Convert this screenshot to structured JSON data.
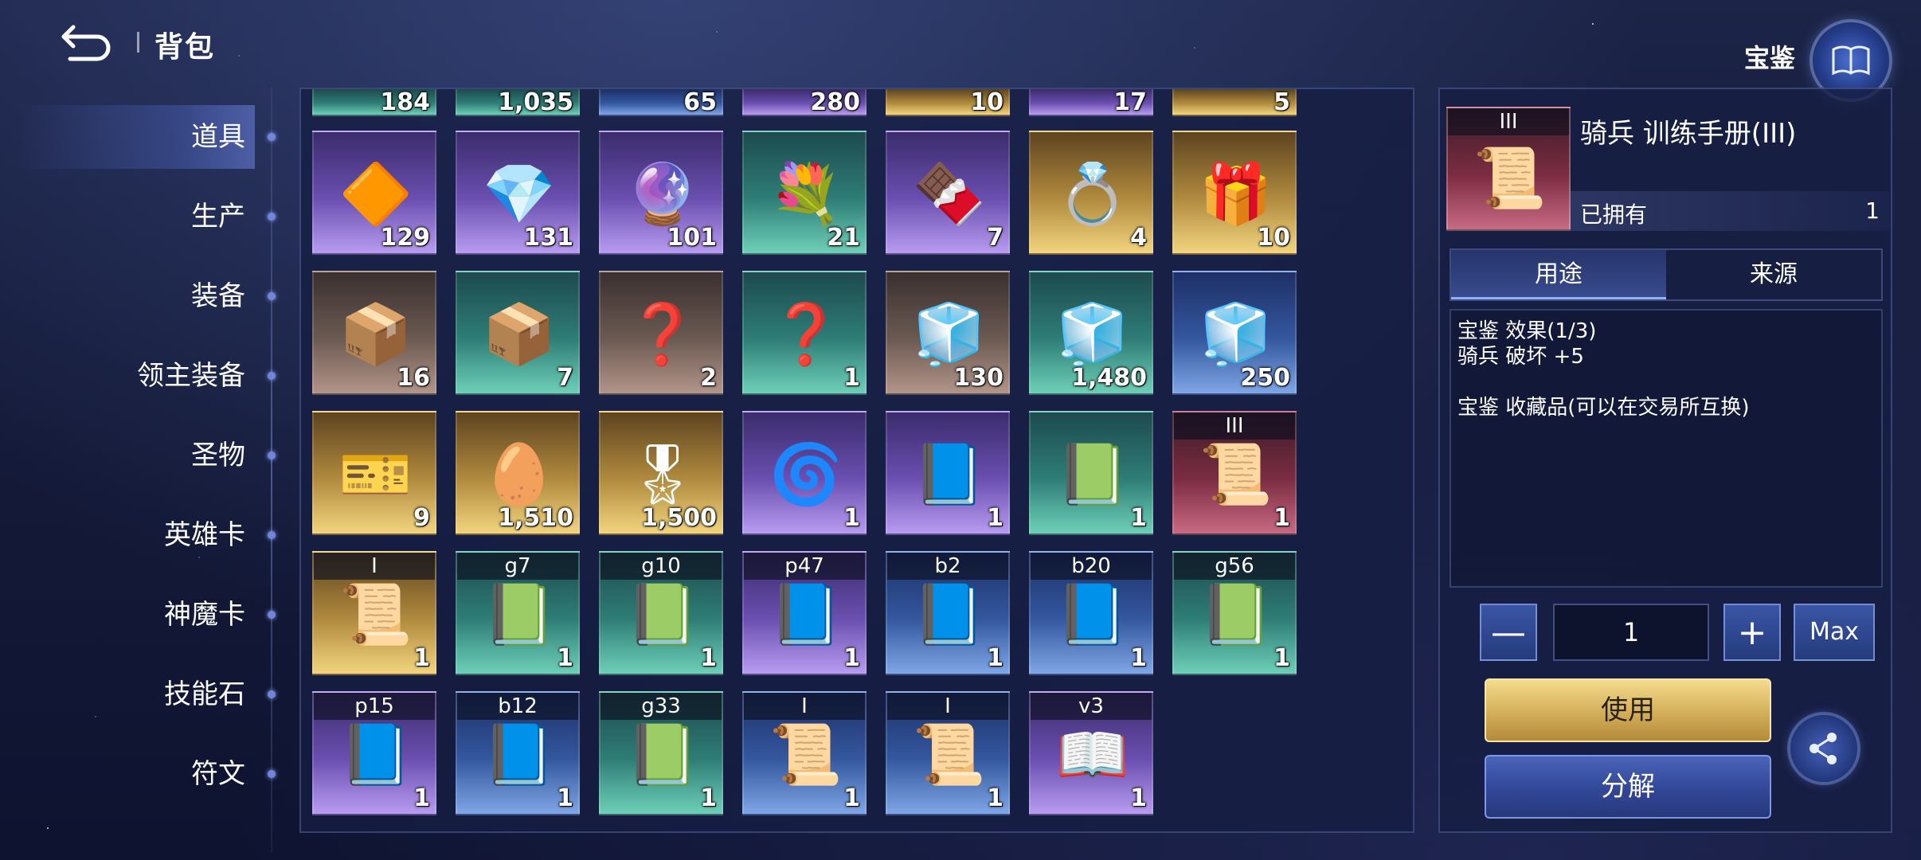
{
  "header": {
    "title": "背包",
    "codex_label": "宝鉴"
  },
  "sidebar": {
    "items": [
      {
        "label": "道具",
        "active": true
      },
      {
        "label": "生产",
        "active": false
      },
      {
        "label": "装备",
        "active": false
      },
      {
        "label": "领主装备",
        "active": false
      },
      {
        "label": "圣物",
        "active": false
      },
      {
        "label": "英雄卡",
        "active": false
      },
      {
        "label": "神魔卡",
        "active": false
      },
      {
        "label": "技能石",
        "active": false
      },
      {
        "label": "符文",
        "active": false
      }
    ]
  },
  "grid": {
    "top_strip": [
      {
        "count": "184",
        "quality": "teal"
      },
      {
        "count": "1,035",
        "quality": "teal"
      },
      {
        "count": "65",
        "quality": "blue"
      },
      {
        "count": "280",
        "quality": "purple"
      },
      {
        "count": "10",
        "quality": "gold"
      },
      {
        "count": "17",
        "quality": "purple"
      },
      {
        "count": "5",
        "quality": "gold"
      }
    ],
    "rows": [
      [
        {
          "count": "129",
          "quality": "purple",
          "icon": "orange-crystal-icon",
          "glyph": "🔶",
          "tag": ""
        },
        {
          "count": "131",
          "quality": "purple",
          "icon": "blue-crystal-icon",
          "glyph": "💎",
          "tag": ""
        },
        {
          "count": "101",
          "quality": "purple",
          "icon": "violet-crystal-icon",
          "glyph": "🔮",
          "tag": ""
        },
        {
          "count": "21",
          "quality": "teal",
          "icon": "flower-bouquet-icon",
          "glyph": "💐",
          "tag": ""
        },
        {
          "count": "7",
          "quality": "purple",
          "icon": "chocolate-box-icon",
          "glyph": "🍫",
          "tag": ""
        },
        {
          "count": "4",
          "quality": "gold",
          "icon": "ring-box-icon",
          "glyph": "💍",
          "tag": ""
        },
        {
          "count": "10",
          "quality": "gold",
          "icon": "gift-chest-icon",
          "glyph": "🎁",
          "tag": ""
        }
      ],
      [
        {
          "count": "16",
          "quality": "brown",
          "icon": "gold-chest-icon",
          "glyph": "📦",
          "tag": ""
        },
        {
          "count": "7",
          "quality": "teal",
          "icon": "gold-chest-icon",
          "glyph": "📦",
          "tag": ""
        },
        {
          "count": "2",
          "quality": "brown",
          "icon": "mystery-chest-icon",
          "glyph": "❓",
          "tag": ""
        },
        {
          "count": "1",
          "quality": "teal",
          "icon": "mystery-chest-icon",
          "glyph": "❓",
          "tag": ""
        },
        {
          "count": "130",
          "quality": "brown",
          "icon": "crystal-chest-icon",
          "glyph": "🧊",
          "tag": ""
        },
        {
          "count": "1,480",
          "quality": "teal",
          "icon": "crystal-chest-icon",
          "glyph": "🧊",
          "tag": ""
        },
        {
          "count": "250",
          "quality": "blue",
          "icon": "crystal-chest-icon",
          "glyph": "🧊",
          "tag": ""
        }
      ],
      [
        {
          "count": "9",
          "quality": "gold",
          "icon": "ticket-icon",
          "glyph": "🎫",
          "tag": ""
        },
        {
          "count": "1,510",
          "quality": "gold",
          "icon": "easter-egg-icon",
          "glyph": "🥚",
          "tag": ""
        },
        {
          "count": "1,500",
          "quality": "gold",
          "icon": "medal-icon",
          "glyph": "🎖",
          "tag": ""
        },
        {
          "count": "1",
          "quality": "purple",
          "icon": "portal-scroll-icon",
          "glyph": "🌀",
          "tag": ""
        },
        {
          "count": "1",
          "quality": "purple",
          "icon": "skill-book-icon",
          "glyph": "📘",
          "tag": ""
        },
        {
          "count": "1",
          "quality": "teal",
          "icon": "skill-book-icon",
          "glyph": "📗",
          "tag": ""
        },
        {
          "count": "1",
          "quality": "red",
          "icon": "manual-scroll-icon",
          "glyph": "📜",
          "tag": "III"
        }
      ],
      [
        {
          "count": "1",
          "quality": "gold",
          "icon": "manual-scroll-icon",
          "glyph": "📜",
          "tag": "I"
        },
        {
          "count": "1",
          "quality": "teal",
          "icon": "skill-book-icon",
          "glyph": "📗",
          "tag": "g7"
        },
        {
          "count": "1",
          "quality": "teal",
          "icon": "skill-book-icon",
          "glyph": "📗",
          "tag": "g10"
        },
        {
          "count": "1",
          "quality": "purple",
          "icon": "skill-book-icon",
          "glyph": "📘",
          "tag": "p47"
        },
        {
          "count": "1",
          "quality": "blue",
          "icon": "skill-book-icon",
          "glyph": "📘",
          "tag": "b2"
        },
        {
          "count": "1",
          "quality": "blue",
          "icon": "skill-book-icon",
          "glyph": "📘",
          "tag": "b20"
        },
        {
          "count": "1",
          "quality": "teal",
          "icon": "skill-book-icon",
          "glyph": "📗",
          "tag": "g56"
        }
      ],
      [
        {
          "count": "1",
          "quality": "purple",
          "icon": "skill-book-icon",
          "glyph": "📘",
          "tag": "p15"
        },
        {
          "count": "1",
          "quality": "blue",
          "icon": "skill-book-icon",
          "glyph": "📘",
          "tag": "b12"
        },
        {
          "count": "1",
          "quality": "teal",
          "icon": "skill-book-icon",
          "glyph": "📗",
          "tag": "g33"
        },
        {
          "count": "1",
          "quality": "blue",
          "icon": "manual-scroll-icon",
          "glyph": "📜",
          "tag": "I"
        },
        {
          "count": "1",
          "quality": "blue",
          "icon": "manual-scroll-icon",
          "glyph": "📜",
          "tag": "I"
        },
        {
          "count": "1",
          "quality": "purple",
          "icon": "tome-icon",
          "glyph": "📖",
          "tag": "v3"
        }
      ]
    ]
  },
  "detail": {
    "tag": "III",
    "glyph": "📜",
    "name": "骑兵 训练手册(III)",
    "owned_label": "已拥有",
    "owned_value": "1",
    "tabs": [
      "用途",
      "来源"
    ],
    "description": [
      "宝鉴 效果(1/3)",
      "骑兵 破坏 +5",
      "",
      "宝鉴 收藏品(可以在交易所互换)"
    ],
    "minus_label": "—",
    "plus_label": "+",
    "quantity": "1",
    "max_label": "Max",
    "use_label": "使用",
    "decompose_label": "分解"
  },
  "colors": {
    "purple": "#6a4fb0",
    "teal": "#2f7d76",
    "gold": "#b08a3e",
    "blue": "#34579e",
    "brown": "#6b5a52",
    "red": "#7b2c42"
  }
}
